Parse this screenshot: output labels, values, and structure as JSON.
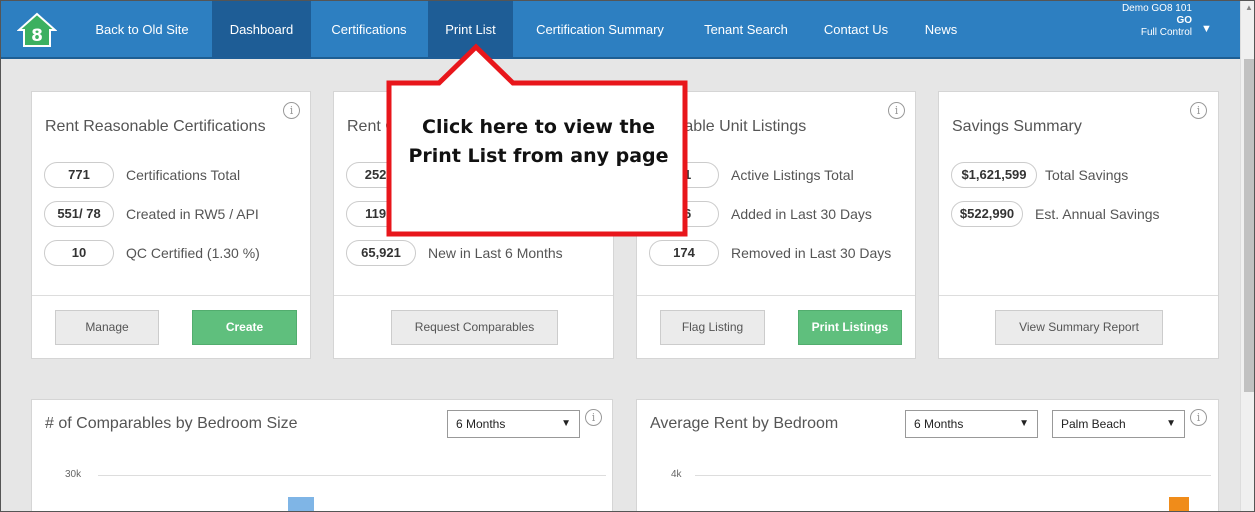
{
  "nav": {
    "items": [
      {
        "label": "Back to Old Site"
      },
      {
        "label": "Dashboard"
      },
      {
        "label": "Certifications"
      },
      {
        "label": "Print List"
      },
      {
        "label": "Certification Summary"
      },
      {
        "label": "Tenant Search"
      },
      {
        "label": "Contact Us"
      },
      {
        "label": "News"
      }
    ],
    "user": {
      "name": "Demo GO8 101",
      "code": "GO",
      "role": "Full Control"
    },
    "logo_text": "8"
  },
  "callout": {
    "text": "Click here to view the Print List from any page"
  },
  "cards": {
    "rent_reasonable": {
      "title": "Rent Reasonable Certifications",
      "stats": [
        {
          "value": "771",
          "label": "Certifications Total"
        },
        {
          "value": "551/ 78",
          "label": "Created in RW5 / API"
        },
        {
          "value": "10",
          "label": "QC Certified (1.30 %)"
        }
      ],
      "buttons": {
        "manage": "Manage",
        "create": "Create"
      }
    },
    "comparables": {
      "title": "Rent Comparables",
      "stats": [
        {
          "value": "252,1",
          "label": ""
        },
        {
          "value": "119,9",
          "label": ""
        },
        {
          "value": "65,921",
          "label": "New in Last 6 Months"
        }
      ],
      "buttons": {
        "request": "Request Comparables"
      }
    },
    "listings": {
      "title": "Available Unit Listings",
      "stats": [
        {
          "value": "01",
          "label": "Active Listings Total"
        },
        {
          "value": "36",
          "label": "Added in Last 30 Days"
        },
        {
          "value": "174",
          "label": "Removed in Last 30 Days"
        }
      ],
      "buttons": {
        "flag": "Flag Listing",
        "print": "Print Listings"
      }
    },
    "savings": {
      "title": "Savings Summary",
      "stats": [
        {
          "value": "$1,621,599",
          "label": "Total Savings"
        },
        {
          "value": "$522,990",
          "label": "Est. Annual Savings"
        }
      ],
      "buttons": {
        "report": "View Summary Report"
      }
    }
  },
  "charts": {
    "comparables_by_bedroom": {
      "title": "# of Comparables by Bedroom Size",
      "period": "6 Months",
      "y_top_label": "30k"
    },
    "avg_rent_by_bedroom": {
      "title": "Average Rent by Bedroom",
      "period": "6 Months",
      "region": "Palm Beach",
      "y_top_label": "4k"
    }
  },
  "info_glyph": "i",
  "caret_glyph": "▼",
  "colors": {
    "nav_bg": "#2d7fc1",
    "nav_active": "#1e5d96",
    "accent_green": "#5fbf7d",
    "callout_border": "#e8161b",
    "bar_blue": "#7fb5e6",
    "bar_orange": "#f08c1a"
  }
}
